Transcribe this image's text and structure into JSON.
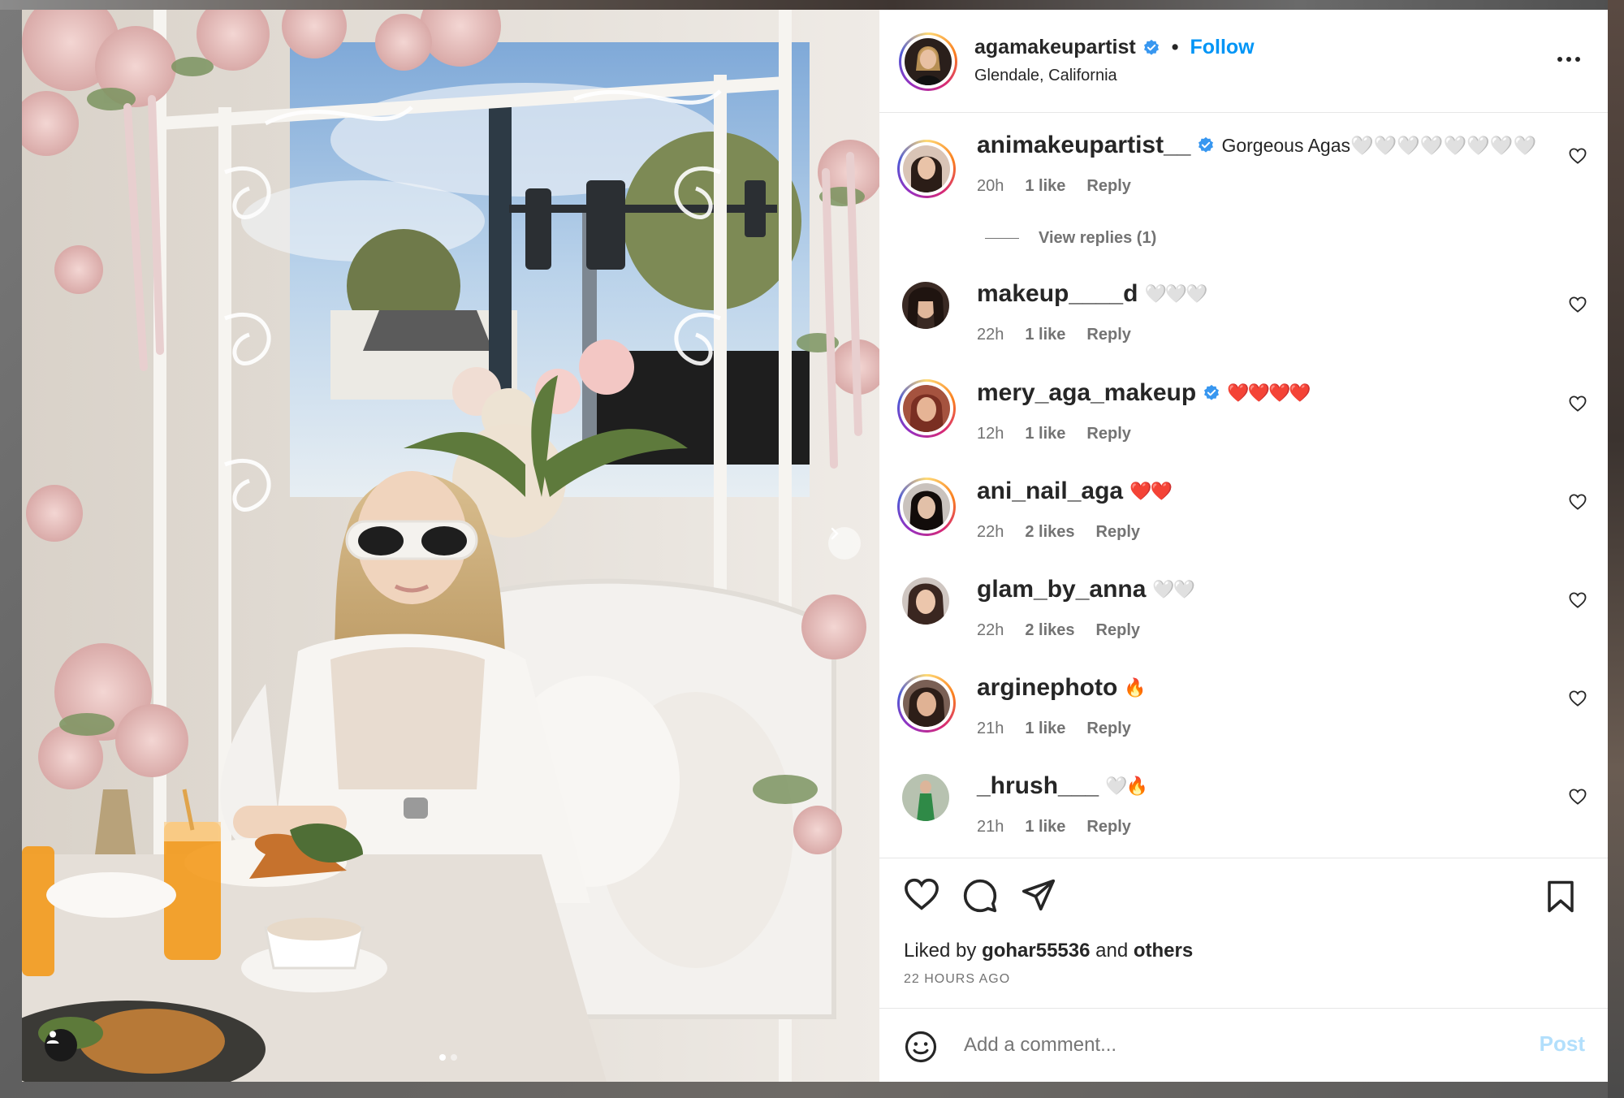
{
  "post": {
    "username": "agamakeupartist",
    "separator": "•",
    "follow_label": "Follow",
    "location": "Glendale, California"
  },
  "comments": [
    {
      "username": "animakeupartist__",
      "verified": true,
      "text": "Gorgeous Agas🤍🤍🤍🤍🤍🤍🤍🤍",
      "time": "20h",
      "likes": "1 like",
      "reply": "Reply"
    },
    {
      "username": "makeup____d",
      "verified": false,
      "text": "🤍🤍🤍",
      "time": "22h",
      "likes": "1 like",
      "reply": "Reply"
    },
    {
      "username": "mery_aga_makeup",
      "verified": true,
      "text": "❤️❤️❤️❤️",
      "time": "12h",
      "likes": "1 like",
      "reply": "Reply"
    },
    {
      "username": "ani_nail_aga",
      "verified": false,
      "text": "❤️❤️",
      "time": "22h",
      "likes": "2 likes",
      "reply": "Reply"
    },
    {
      "username": "glam_by_anna",
      "verified": false,
      "text": "🤍🤍",
      "time": "22h",
      "likes": "2 likes",
      "reply": "Reply"
    },
    {
      "username": "arginephoto",
      "verified": false,
      "text": "🔥",
      "time": "21h",
      "likes": "1 like",
      "reply": "Reply"
    },
    {
      "username": "_hrush___",
      "verified": false,
      "text": "🤍🔥",
      "time": "21h",
      "likes": "1 like",
      "reply": "Reply"
    }
  ],
  "view_replies_label": "View replies (1)",
  "liked_by": {
    "prefix": "Liked by",
    "user": "gohar55536",
    "conjunction": "and",
    "others": "others"
  },
  "timestamp": "22 HOURS AGO",
  "add_comment": {
    "placeholder": "Add a comment...",
    "post_label": "Post"
  },
  "colors": {
    "link": "#0095f6",
    "verified": "#3897f0",
    "muted": "#737373",
    "text": "#262626",
    "post_disabled": "#b2dffc"
  },
  "icons": [
    "heart-icon",
    "comment-icon",
    "share-icon",
    "bookmark-icon",
    "emoji-icon",
    "more-icon",
    "verified-icon",
    "chevron-right-icon",
    "user-tag-icon"
  ]
}
